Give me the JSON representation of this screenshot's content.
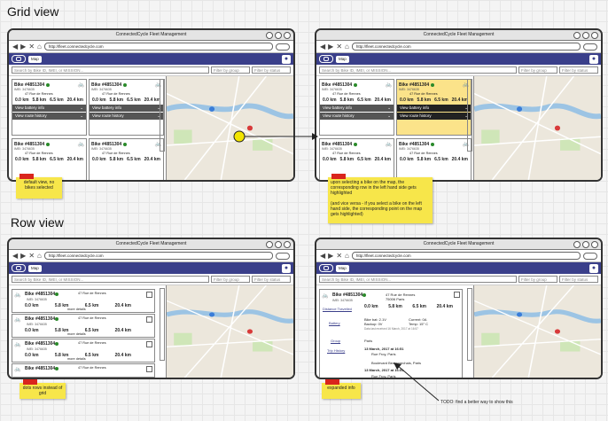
{
  "titles": {
    "grid": "Grid view",
    "row": "Row view"
  },
  "app": {
    "window_title": "ConnectedCycle Fleet Management",
    "url_full": "http://fleet.connectedcycle.com",
    "url_short": "http://fleet.connectedcycle.com",
    "map_select": "Map",
    "search_placeholder": "Search by Bike ID, IMEI, or MISSION...",
    "filter_group": "Filter by group",
    "filter_status": "Filter by status"
  },
  "bike": {
    "id": "Bike #4851304",
    "imei": "IMEI: 3476635",
    "mission": "MISSION: 567GPS34",
    "addr1": "47 Rue de Rennes",
    "addr2": "75006 Paris",
    "date": "16 March, 2017 at 16:57",
    "stats": [
      "0.0 km",
      "5.8 km",
      "6.5 km",
      "20.4 km"
    ],
    "stat_labels": [
      "day",
      "week",
      "month",
      "total"
    ],
    "battery": "View battery info",
    "route": "View route history",
    "more": "more details"
  },
  "expanded": {
    "distance": "Distance Travelled",
    "battery": "Battery",
    "batt_vals": [
      "Bike bat: 2.1V",
      "Backup: 0V",
      "Current: 0A",
      "Temp: 15° C"
    ],
    "batt_note": "Data last received 16 March, 2017 at 16:57",
    "group": "Group",
    "group_val": "Paris",
    "trip": "Trip History",
    "trip1": "13 March, 2017 at 16:51",
    "trip1a": "Rue Froy, Paris",
    "trip1b": "Boulevard Beaumarchais, Paris",
    "trip2": "13 March, 2017 at 16:51",
    "trip2a": "Rue Froy, Paris"
  },
  "notes": {
    "n1": "default view, no bikes selected",
    "n2": "upon selecting a bike on the map, the corresponding row in the left hand side gets highlighted\n\n(and vice versa - if you select a bike on the left hand side, the corresponding point on the map gets highlighted)",
    "n3": "dots rows instead of grid",
    "n4": "expanded info",
    "todo": "TODO: find a better way to show this"
  },
  "colors": {
    "accent": "#3a3f8a",
    "note": "#f7e64a",
    "highlight": "#fbe38a"
  }
}
